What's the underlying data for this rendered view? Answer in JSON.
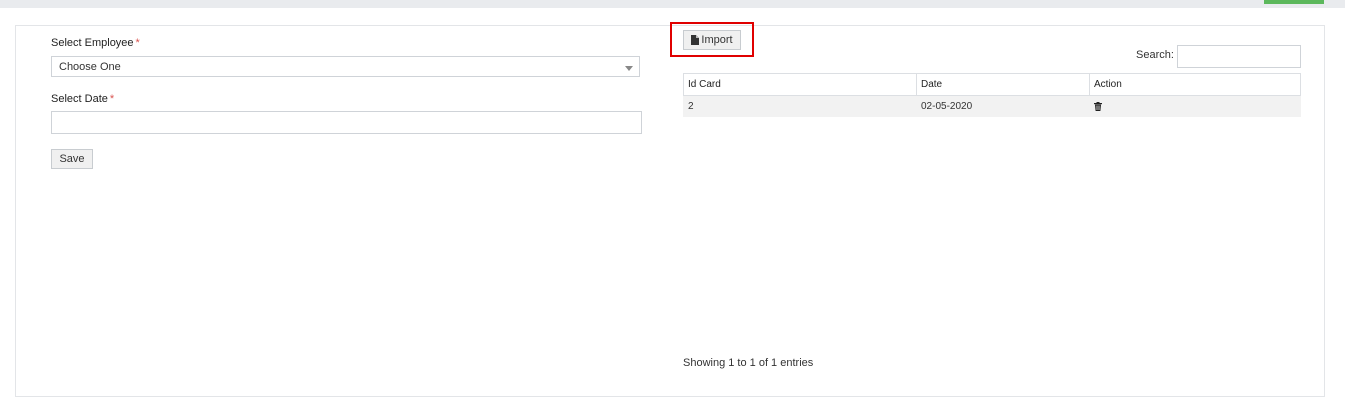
{
  "form": {
    "employee_label": "Select Employee",
    "required_mark": "*",
    "employee_value": "Choose One",
    "date_label": "Select Date",
    "date_value": "",
    "save_label": "Save"
  },
  "toolbar": {
    "import_label": "Import",
    "import_icon": "file-icon"
  },
  "search": {
    "label": "Search:",
    "value": ""
  },
  "table": {
    "columns": [
      "Id Card",
      "Date",
      "Action"
    ],
    "rows": [
      {
        "id_card": "2",
        "date": "02-05-2020",
        "action_icon": "trash-icon"
      }
    ]
  },
  "footer": {
    "info": "Showing 1 to 1 of 1 entries"
  },
  "colors": {
    "highlight": "#e00000",
    "accent": "#5cb85c",
    "required": "#d9534f"
  }
}
